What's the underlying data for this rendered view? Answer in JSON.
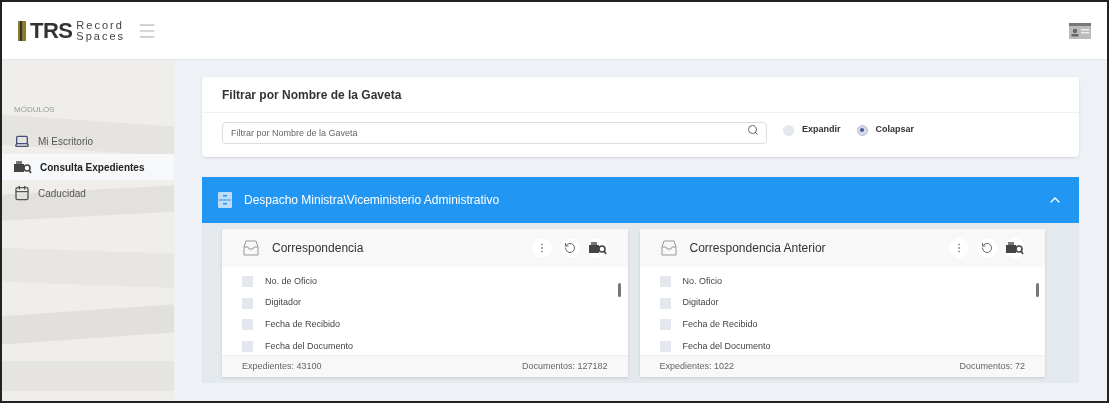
{
  "header": {
    "logo_mark": "TRS",
    "logo_text_top": "Record",
    "logo_text_bottom": "Spaces"
  },
  "sidebar": {
    "section": "MÓDULOS",
    "items": [
      {
        "label": "Mi Escritorio",
        "kind": "laptop",
        "selected": false
      },
      {
        "label": "Consulta Expedientes",
        "kind": "search-docs",
        "selected": true
      },
      {
        "label": "Caducidad",
        "kind": "calendar",
        "selected": false
      }
    ]
  },
  "filter": {
    "title": "Filtrar por Nombre de la Gaveta",
    "placeholder": "Filtrar por Nombre de la Gaveta",
    "options": [
      {
        "label": "Expandir",
        "selected": false
      },
      {
        "label": "Colapsar",
        "selected": true
      }
    ]
  },
  "group": {
    "title": "Despacho Ministra\\Viceministerio Administrativo",
    "expanded": true,
    "drawers": [
      {
        "title": "Correspondencia",
        "fields": [
          {
            "label": "No. de Oficio",
            "checked": false
          },
          {
            "label": "Digitador",
            "checked": false
          },
          {
            "label": "Fecha de Recibido",
            "checked": false
          },
          {
            "label": "Fecha del Documento",
            "checked": false
          }
        ],
        "expedientes": "Expedientes: 43100",
        "documentos": "Documentos: 127182"
      },
      {
        "title": "Correspondencia Anterior",
        "fields": [
          {
            "label": "No. Oficio",
            "checked": false
          },
          {
            "label": "Digitador",
            "checked": false
          },
          {
            "label": "Fecha de Recibido",
            "checked": false
          },
          {
            "label": "Fecha del Documento",
            "checked": false
          }
        ],
        "expedientes": "Expedientes: 1022",
        "documentos": "Documentos: 72"
      }
    ]
  }
}
